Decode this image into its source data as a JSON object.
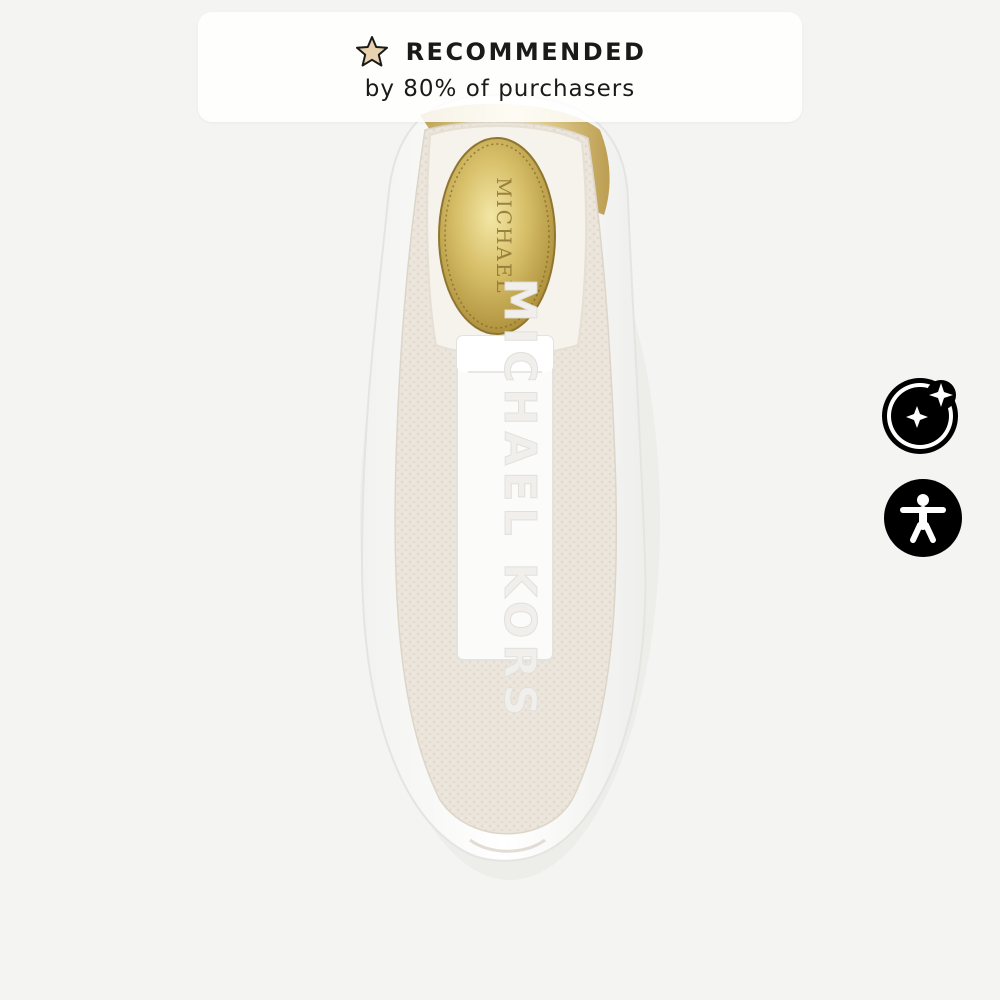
{
  "badge": {
    "title": "RECOMMENDED",
    "subtitle": "by 80% of purchasers",
    "star_color": "#e9d3ae",
    "icon": "star-icon"
  },
  "product": {
    "brand_text": "MICHAEL KORS",
    "insole_text": "MICHAEL",
    "colors": {
      "background": "#f4f4f2",
      "knit": "#ece6de",
      "sole": "#fbfbfa",
      "gold": "#d2b85a"
    }
  },
  "side_buttons": {
    "assistant_icon": "ai-sparkle-icon",
    "accessibility_icon": "accessibility-person-icon"
  }
}
